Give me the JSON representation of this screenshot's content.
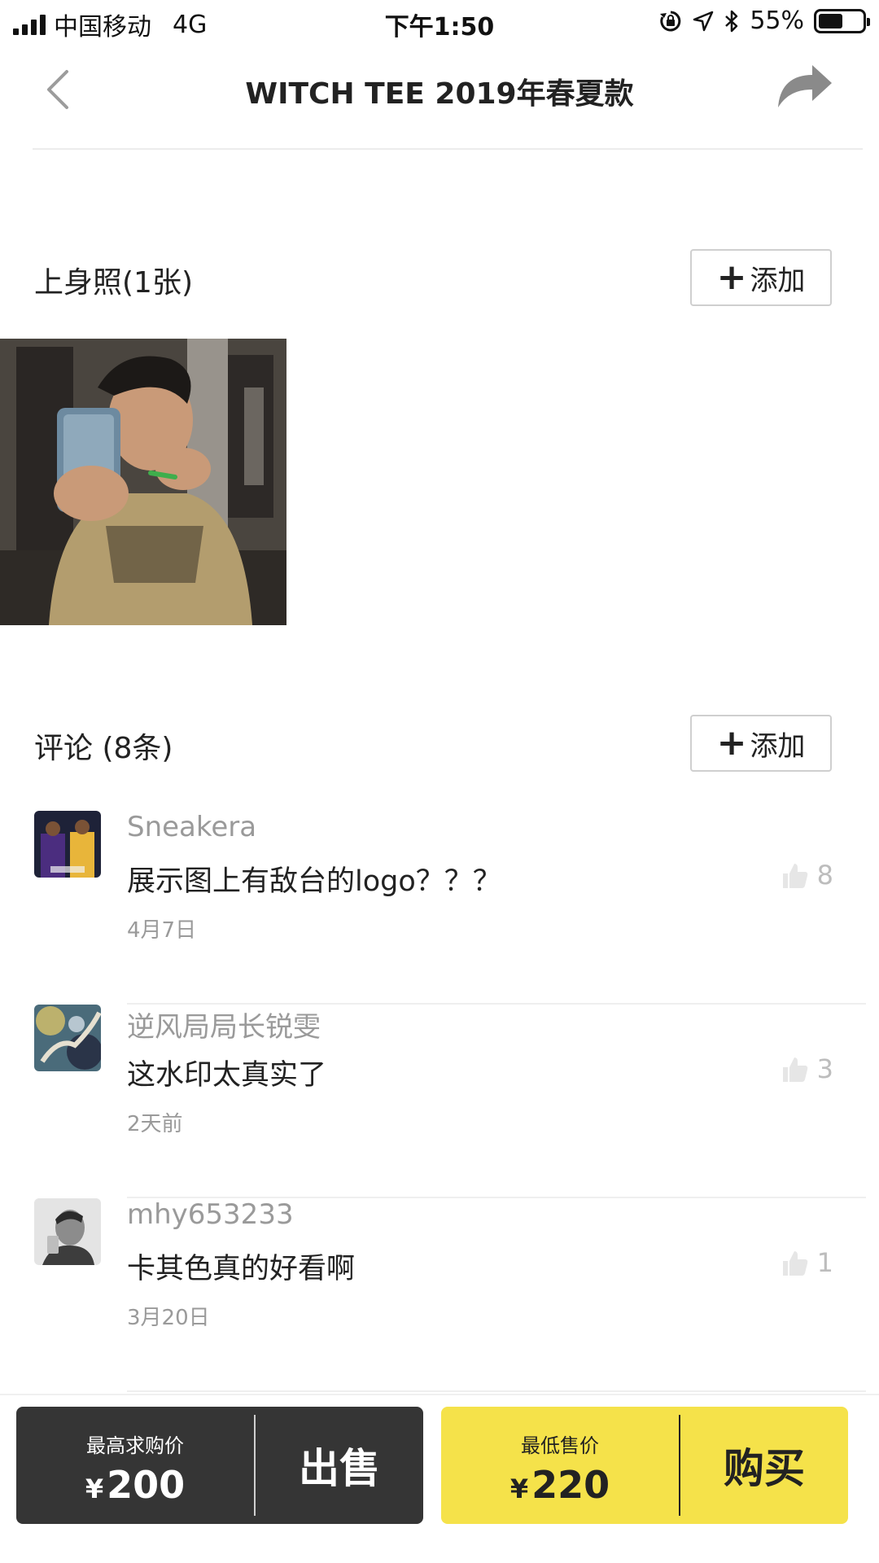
{
  "status_bar": {
    "carrier": "中国移动",
    "network": "4G",
    "time": "下午1:50",
    "battery": "55%",
    "battery_level": 0.55
  },
  "nav": {
    "title": "WITCH TEE 2019年春夏款",
    "back_icon": "chevron-left-icon",
    "share_icon": "share-arrow-icon"
  },
  "photos_section": {
    "title": "上身照(1张)",
    "add_label": "添加"
  },
  "comments_section": {
    "title": "评论 (8条)",
    "add_label": "添加",
    "items": [
      {
        "user": "Sneakera",
        "text": "展示图上有敌台的logo？？？",
        "date": "4月7日",
        "likes": "8"
      },
      {
        "user": "逆风局局长锐雯",
        "text": "这水印太真实了",
        "date": "2天前",
        "likes": "3"
      },
      {
        "user": "mhy653233",
        "text": "卡其色真的好看啊",
        "date": "3月20日",
        "likes": "1"
      }
    ]
  },
  "bottom_bar": {
    "sell": {
      "label": "最高求购价",
      "currency": "¥",
      "price": "200",
      "action": "出售"
    },
    "buy": {
      "label": "最低售价",
      "currency": "¥",
      "price": "220",
      "action": "购买"
    }
  },
  "colors": {
    "accent_yellow": "#f5e24a",
    "dark_box": "#353535",
    "muted_text": "#9a9a9a"
  }
}
